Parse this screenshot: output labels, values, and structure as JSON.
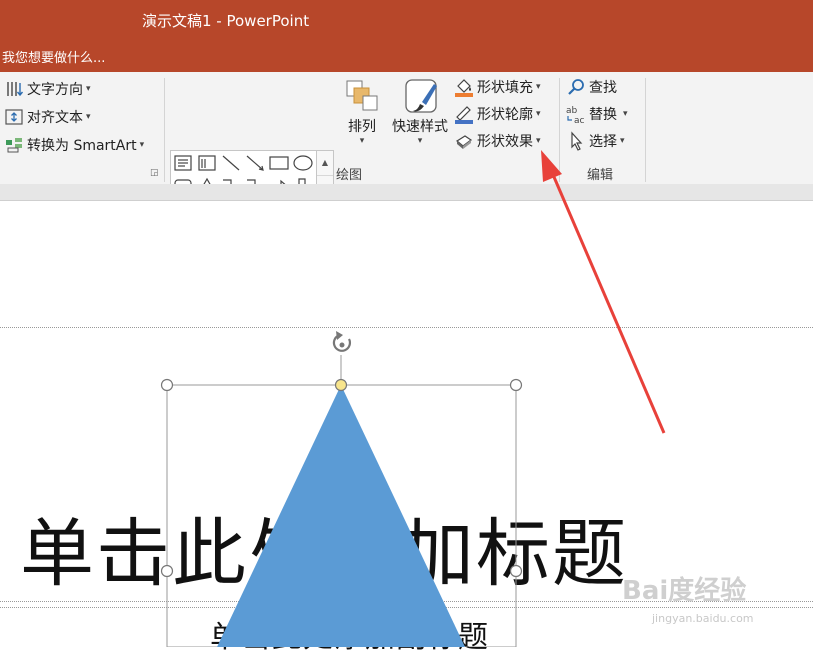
{
  "window": {
    "title": "演示文稿1 - PowerPoint",
    "tell_me": "我您想要做什么..."
  },
  "ribbon": {
    "paragraph_group": {
      "text_direction": "文字方向",
      "align_text": "对齐文本",
      "convert_smartart": "转换为 SmartArt"
    },
    "drawing_group": {
      "label": "绘图",
      "arrange": "排列",
      "quick_styles": "快速样式",
      "shape_fill": "形状填充",
      "shape_outline": "形状轮廓",
      "shape_effects": "形状效果"
    },
    "editing_group": {
      "label": "编辑",
      "find": "查找",
      "replace": "替换",
      "select": "选择"
    }
  },
  "slide": {
    "title_placeholder": "单击此处添加标题",
    "subtitle_placeholder": "单击此处添加副标题",
    "shape": {
      "type": "isosceles-triangle",
      "fill_color": "#5b9bd5"
    }
  },
  "watermark": {
    "text": "Bai度经验",
    "url": "jingyan.baidu.com"
  },
  "colors": {
    "accent": "#b7472a",
    "annotation_arrow": "#e8413a"
  },
  "icons": [
    "text-direction-icon",
    "align-text-icon",
    "smartart-icon",
    "arrange-icon",
    "quick-styles-icon",
    "shape-fill-icon",
    "shape-outline-icon",
    "shape-effects-icon",
    "find-icon",
    "replace-icon",
    "select-icon",
    "rotate-handle-icon"
  ]
}
